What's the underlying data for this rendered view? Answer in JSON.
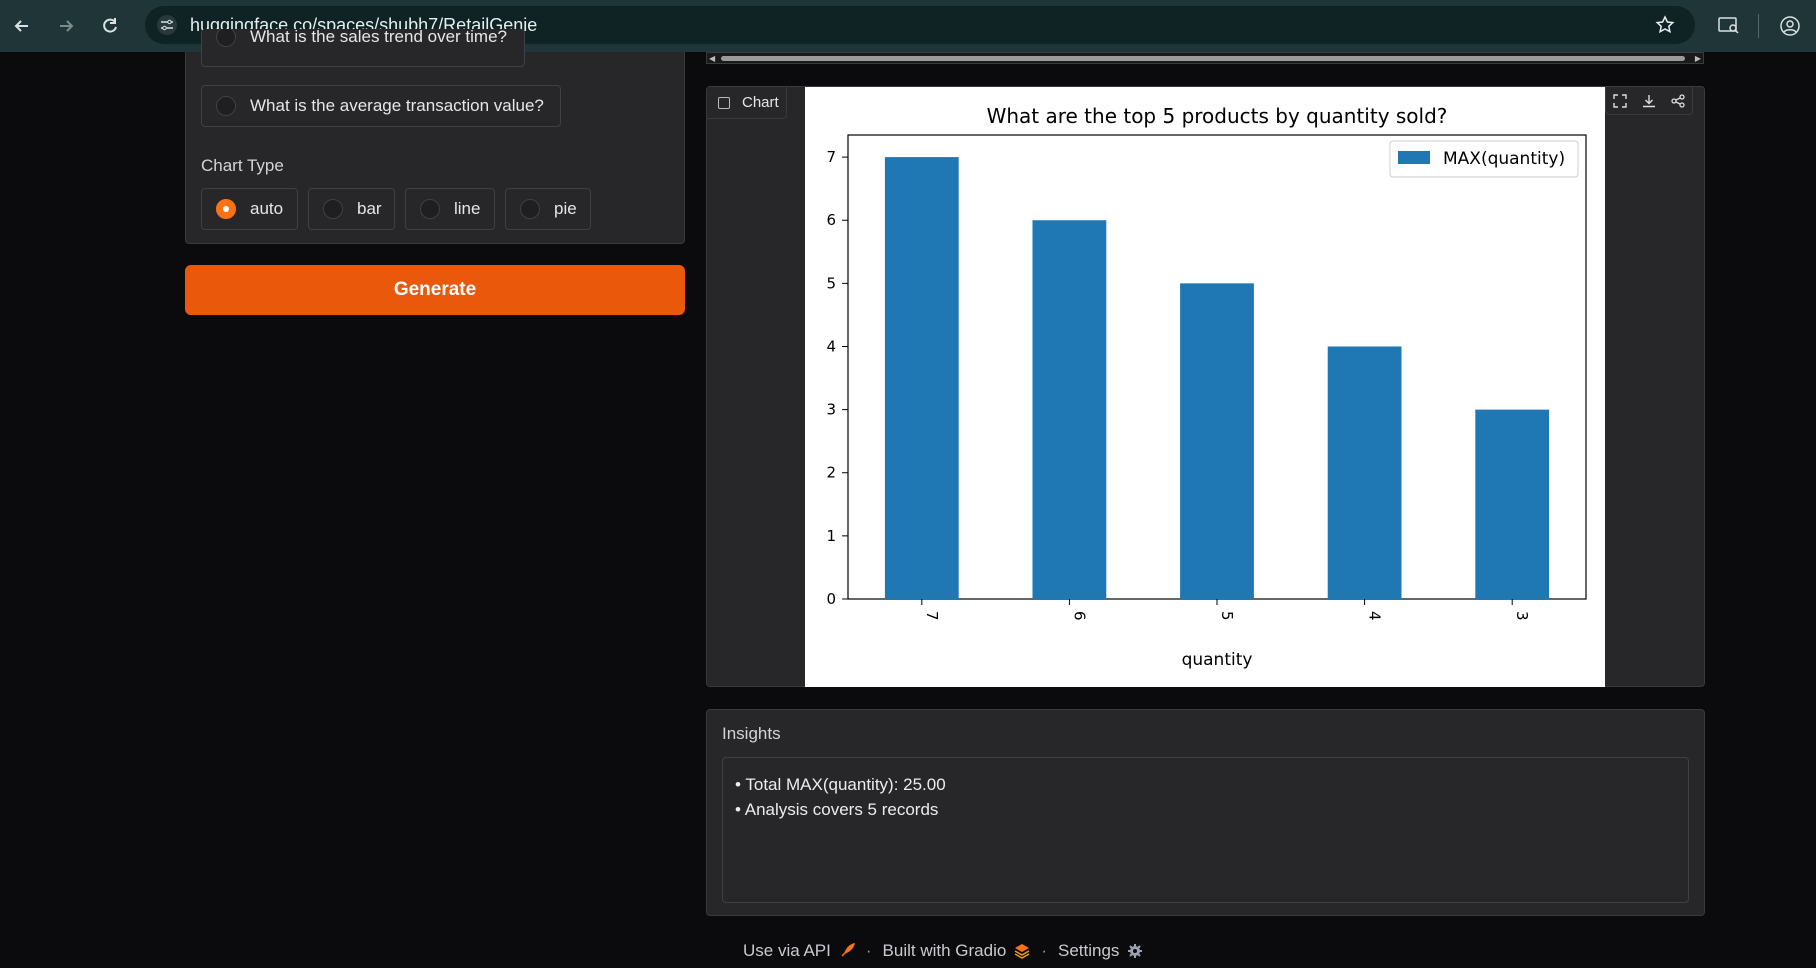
{
  "browser": {
    "url": "huggingface.co/spaces/shubh7/RetailGenie"
  },
  "questions": {
    "partial_option": "What is the sales trend over time?",
    "option_avg": "What is the average transaction value?"
  },
  "chart_type": {
    "label": "Chart Type",
    "options": [
      "auto",
      "bar",
      "line",
      "pie"
    ],
    "selected": "auto"
  },
  "generate": {
    "label": "Generate"
  },
  "chart_panel": {
    "tab_label": "Chart"
  },
  "chart_data": {
    "type": "bar",
    "title": "What are the top 5 products by quantity sold?",
    "xlabel": "quantity",
    "ylabel": "",
    "categories": [
      "7",
      "6",
      "5",
      "4",
      "3"
    ],
    "series": [
      {
        "name": "MAX(quantity)",
        "values": [
          7,
          6,
          5,
          4,
          3
        ],
        "color": "#1f77b4"
      }
    ],
    "ylim": [
      0,
      7.35
    ],
    "yticks": [
      0,
      1,
      2,
      3,
      4,
      5,
      6,
      7
    ],
    "legend": "top-right",
    "grid": false
  },
  "insights": {
    "label": "Insights",
    "lines": [
      "• Total MAX(quantity): 25.00",
      "• Analysis covers 5 records"
    ]
  },
  "footer": {
    "api": "Use via API",
    "built": "Built with Gradio",
    "settings": "Settings"
  },
  "colors": {
    "accent": "#ea580c",
    "radio_selected": "#f97316",
    "bar": "#1f77b4"
  }
}
